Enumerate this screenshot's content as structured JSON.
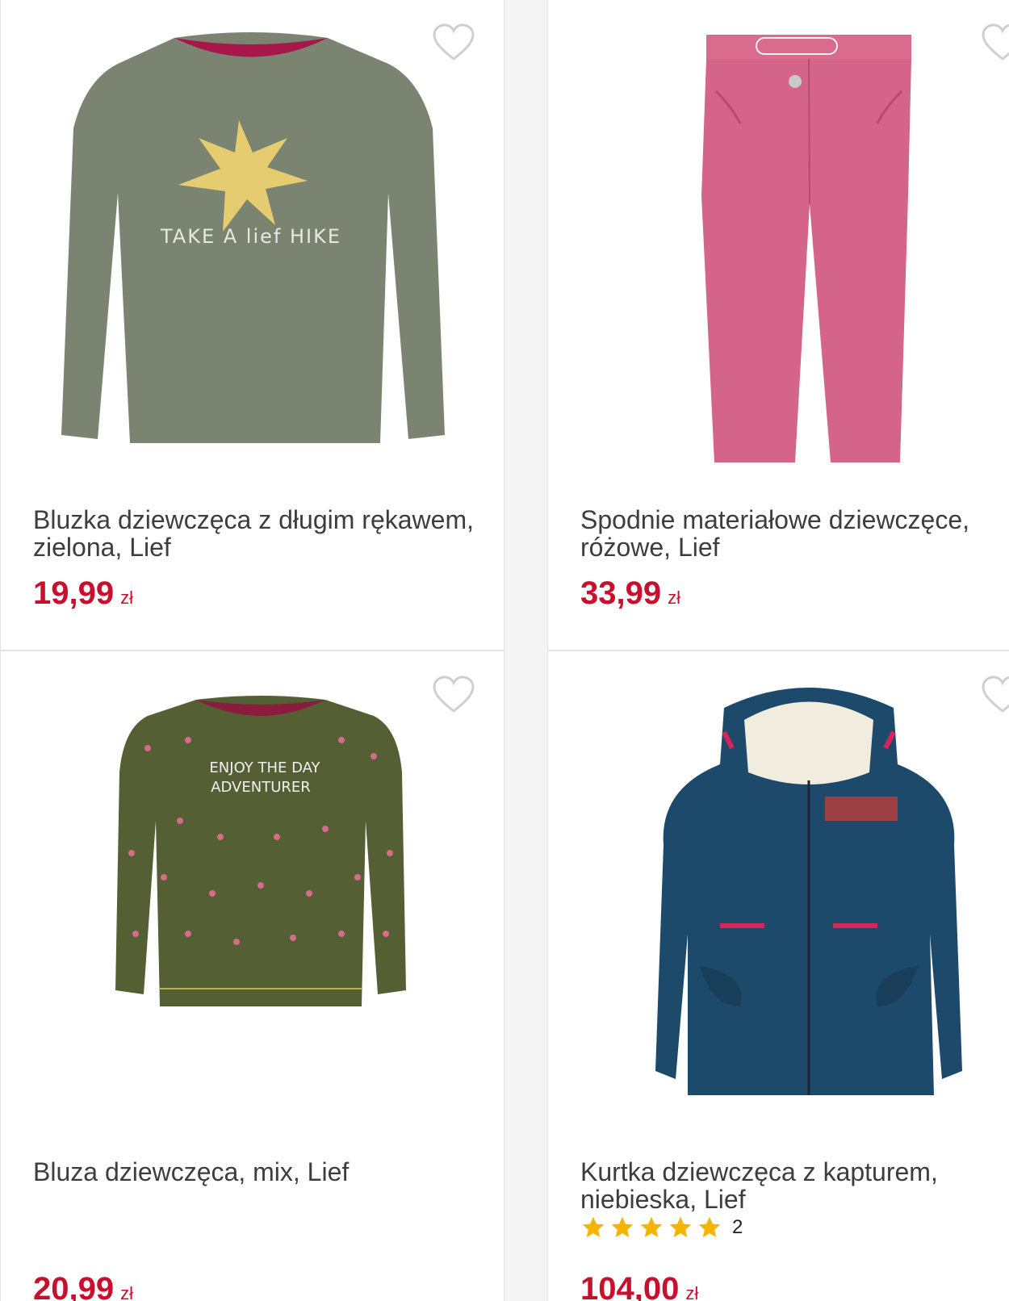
{
  "colors": {
    "price": "#c8102e",
    "title": "#3d3d3d",
    "wishlist": "#cfcfcf",
    "star": "#f4b400"
  },
  "products": [
    {
      "title": "Bluzka dziewczęca z długim rękawem, zielona, Lief",
      "price": "19,99",
      "currency": "zł",
      "print_text": "TAKE A lief HIKE",
      "wishlist_icon": "heart-outline-icon"
    },
    {
      "title": "Spodnie materiałowe dziewczęce, różowe, Lief",
      "price": "33,99",
      "currency": "zł",
      "wishlist_icon": "heart-outline-icon"
    },
    {
      "title": "Bluza dziewczęca, mix, Lief",
      "price": "20,99",
      "currency": "zł",
      "print_text_1": "ENJOY THE DAY",
      "print_text_2": "ADVENTURER",
      "wishlist_icon": "heart-outline-icon"
    },
    {
      "title": "Kurtka dziewczęca z kapturem, niebieska, Lief",
      "price": "104,00",
      "currency": "zł",
      "rating_stars": 5,
      "rating_count": "2",
      "wishlist_icon": "heart-outline-icon"
    }
  ]
}
